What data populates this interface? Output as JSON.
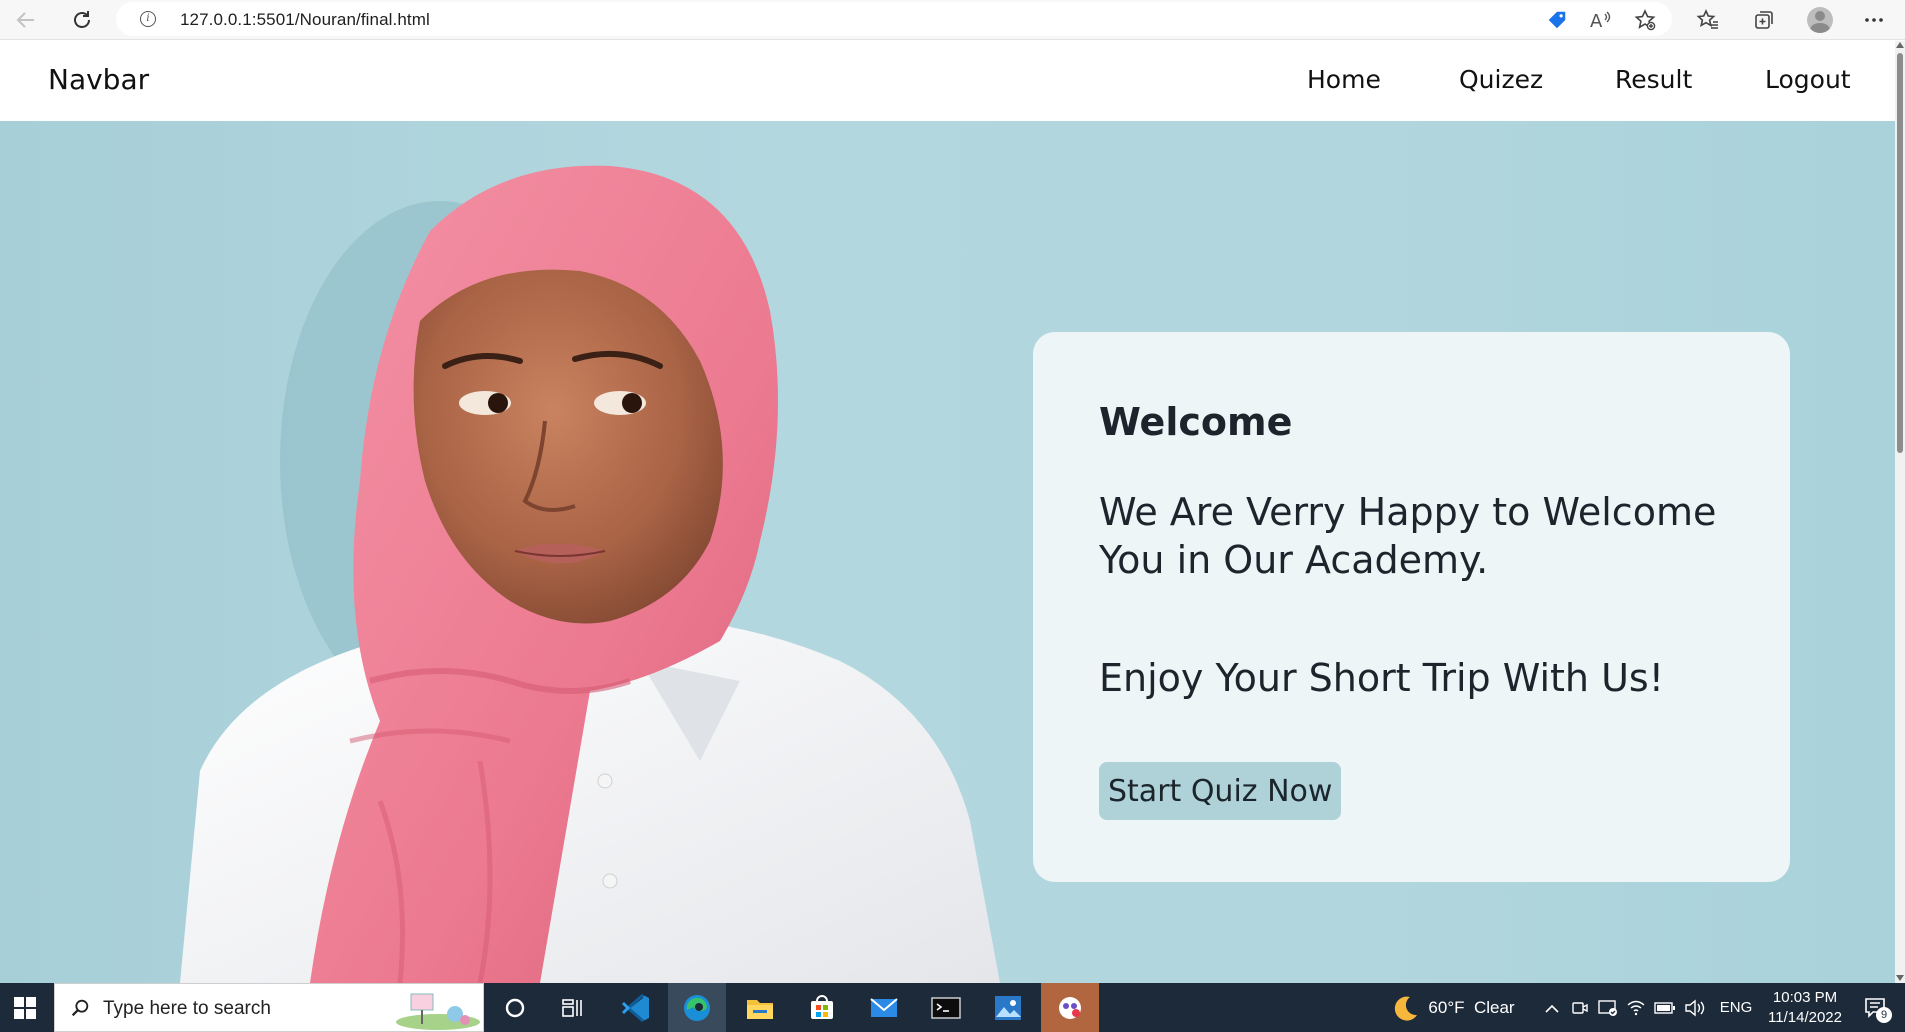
{
  "browser": {
    "url": "127.0.0.1:5501/Nouran/final.html"
  },
  "navbar": {
    "brand": "Navbar",
    "links": [
      {
        "label": "Home"
      },
      {
        "label": "Quizez"
      },
      {
        "label": "Result"
      },
      {
        "label": "Logout"
      }
    ]
  },
  "welcome_card": {
    "title": "Welcome",
    "message_line1": "We Are Verry Happy to Welcome",
    "message_line2": "You in Our Academy.",
    "tagline": "Enjoy Your Short Trip With Us!",
    "button_label": "Start Quiz Now"
  },
  "taskbar": {
    "search_placeholder": "Type here to search",
    "weather": "60°F  Clear",
    "language": "ENG",
    "time": "10:03 PM",
    "date": "11/14/2022",
    "notification_count": "9"
  },
  "colors": {
    "hero_bg": "#aed3db",
    "card_bg": "#eef5f7",
    "button_bg": "#aed2d8",
    "hijab_pink": "#ef7f94",
    "taskbar_bg": "#1d2a3a"
  }
}
